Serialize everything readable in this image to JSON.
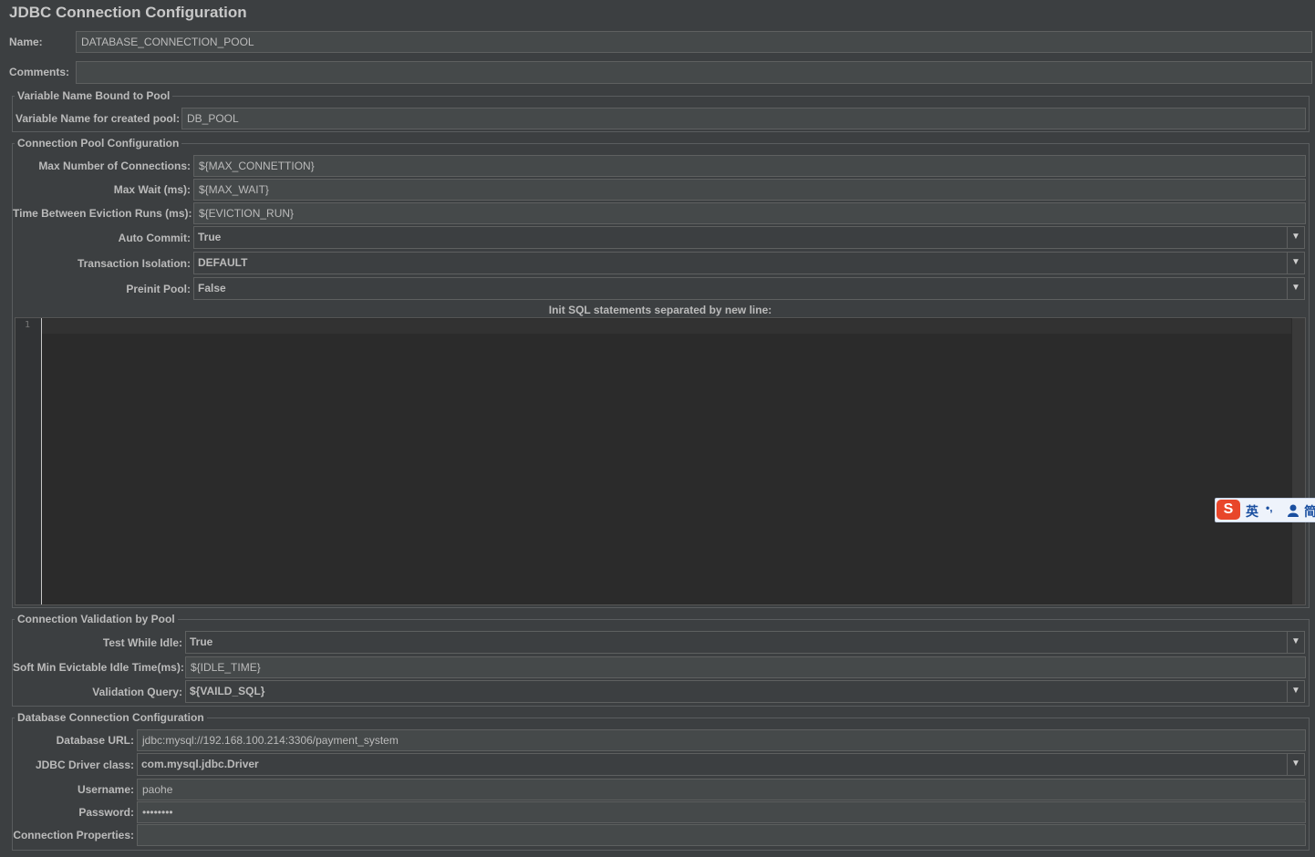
{
  "title": "JDBC Connection Configuration",
  "name": {
    "label": "Name:",
    "value": "DATABASE_CONNECTION_POOL"
  },
  "comments": {
    "label": "Comments:",
    "value": ""
  },
  "variable_group": {
    "title": "Variable Name Bound to Pool",
    "label": "Variable Name for created pool:",
    "value": "DB_POOL"
  },
  "pool_group": {
    "title": "Connection Pool Configuration",
    "max_connections": {
      "label": "Max Number of Connections:",
      "value": "${MAX_CONNETTION}"
    },
    "max_wait": {
      "label": "Max Wait (ms):",
      "value": "${MAX_WAIT}"
    },
    "eviction": {
      "label": "Time Between Eviction Runs (ms):",
      "value": "${EVICTION_RUN}"
    },
    "auto_commit": {
      "label": "Auto Commit:",
      "value": "True"
    },
    "isolation": {
      "label": "Transaction Isolation:",
      "value": "DEFAULT"
    },
    "preinit": {
      "label": "Preinit Pool:",
      "value": "False"
    },
    "init_sql_label": "Init SQL statements separated by new line:",
    "editor_line": "1"
  },
  "validation_group": {
    "title": "Connection Validation by Pool",
    "test_idle": {
      "label": "Test While Idle:",
      "value": "True"
    },
    "soft_min": {
      "label": "Soft Min Evictable Idle Time(ms):",
      "value": "${IDLE_TIME}"
    },
    "query": {
      "label": "Validation Query:",
      "value": "${VAILD_SQL}"
    }
  },
  "db_group": {
    "title": "Database Connection Configuration",
    "url": {
      "label": "Database URL:",
      "value": "jdbc:mysql://192.168.100.214:3306/payment_system"
    },
    "driver": {
      "label": "JDBC Driver class:",
      "value": "com.mysql.jdbc.Driver"
    },
    "username": {
      "label": "Username:",
      "value": "paohe"
    },
    "password": {
      "label": "Password:",
      "value": "••••••••"
    },
    "properties": {
      "label": "Connection Properties:",
      "value": ""
    }
  },
  "ime": {
    "logo": "S",
    "lang": "英",
    "punct": "•,",
    "mode": "简"
  },
  "colors": {
    "background": "#3c3f41",
    "field": "#45494a",
    "editor": "#2b2b2b",
    "ime_red": "#e8462a"
  },
  "icons": {
    "dropdown": "chevron-down-icon",
    "ime_user": "user-icon"
  }
}
